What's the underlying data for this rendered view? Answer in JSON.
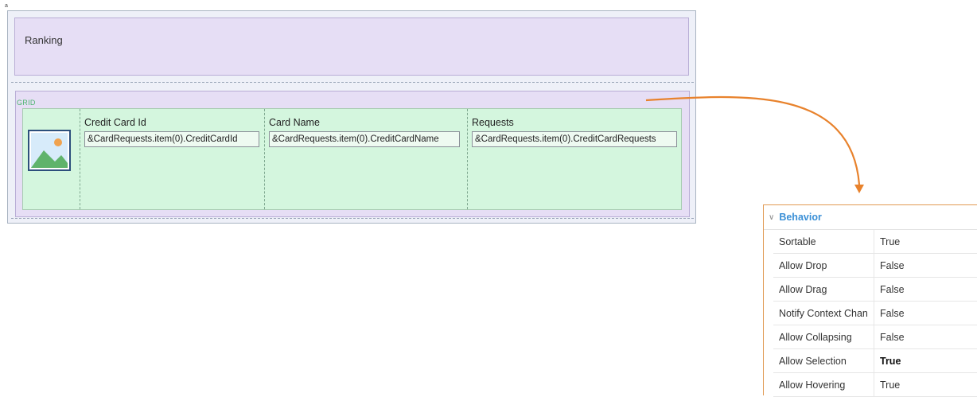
{
  "canvas": {
    "corner_mark": "a",
    "ranking_label": "Ranking",
    "grid_label": "GRID",
    "columns": [
      {
        "header": "Credit Card Id",
        "field": "&CardRequests.item(0).CreditCardId"
      },
      {
        "header": "Card Name",
        "field": "&CardRequests.item(0).CreditCardName"
      },
      {
        "header": "Requests",
        "field": "&CardRequests.item(0).CreditCardRequests"
      }
    ],
    "image_icon": "image-placeholder-icon"
  },
  "arrow": {
    "color": "#e8822c"
  },
  "properties": {
    "section_title": "Behavior",
    "section_icon": "chevron-down-icon",
    "rows": [
      {
        "name": "Sortable",
        "value": "True"
      },
      {
        "name": "Allow Drop",
        "value": "False"
      },
      {
        "name": "Allow Drag",
        "value": "False"
      },
      {
        "name": "Notify Context Chan",
        "value": "False"
      },
      {
        "name": "Allow Collapsing",
        "value": "False"
      },
      {
        "name": "Allow Selection",
        "value": "True"
      },
      {
        "name": "Allow Hovering",
        "value": "True"
      }
    ]
  },
  "colors": {
    "grid_green": "#d4f6de",
    "area_lavender": "#e6def5",
    "behavior_blue": "#3a8fd6",
    "panel_border": "#e19a53"
  }
}
